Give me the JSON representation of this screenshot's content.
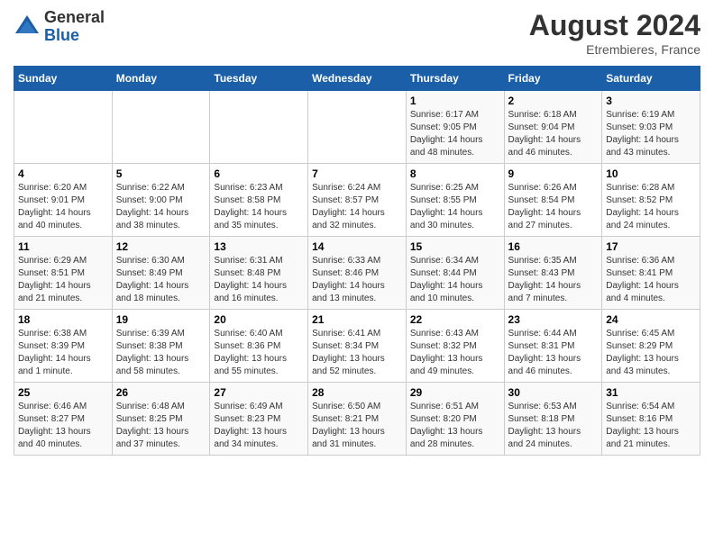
{
  "header": {
    "logo_general": "General",
    "logo_blue": "Blue",
    "month_year": "August 2024",
    "location": "Etrembieres, France"
  },
  "weekdays": [
    "Sunday",
    "Monday",
    "Tuesday",
    "Wednesday",
    "Thursday",
    "Friday",
    "Saturday"
  ],
  "weeks": [
    [
      {
        "day": "",
        "info": ""
      },
      {
        "day": "",
        "info": ""
      },
      {
        "day": "",
        "info": ""
      },
      {
        "day": "",
        "info": ""
      },
      {
        "day": "1",
        "info": "Sunrise: 6:17 AM\nSunset: 9:05 PM\nDaylight: 14 hours and 48 minutes."
      },
      {
        "day": "2",
        "info": "Sunrise: 6:18 AM\nSunset: 9:04 PM\nDaylight: 14 hours and 46 minutes."
      },
      {
        "day": "3",
        "info": "Sunrise: 6:19 AM\nSunset: 9:03 PM\nDaylight: 14 hours and 43 minutes."
      }
    ],
    [
      {
        "day": "4",
        "info": "Sunrise: 6:20 AM\nSunset: 9:01 PM\nDaylight: 14 hours and 40 minutes."
      },
      {
        "day": "5",
        "info": "Sunrise: 6:22 AM\nSunset: 9:00 PM\nDaylight: 14 hours and 38 minutes."
      },
      {
        "day": "6",
        "info": "Sunrise: 6:23 AM\nSunset: 8:58 PM\nDaylight: 14 hours and 35 minutes."
      },
      {
        "day": "7",
        "info": "Sunrise: 6:24 AM\nSunset: 8:57 PM\nDaylight: 14 hours and 32 minutes."
      },
      {
        "day": "8",
        "info": "Sunrise: 6:25 AM\nSunset: 8:55 PM\nDaylight: 14 hours and 30 minutes."
      },
      {
        "day": "9",
        "info": "Sunrise: 6:26 AM\nSunset: 8:54 PM\nDaylight: 14 hours and 27 minutes."
      },
      {
        "day": "10",
        "info": "Sunrise: 6:28 AM\nSunset: 8:52 PM\nDaylight: 14 hours and 24 minutes."
      }
    ],
    [
      {
        "day": "11",
        "info": "Sunrise: 6:29 AM\nSunset: 8:51 PM\nDaylight: 14 hours and 21 minutes."
      },
      {
        "day": "12",
        "info": "Sunrise: 6:30 AM\nSunset: 8:49 PM\nDaylight: 14 hours and 18 minutes."
      },
      {
        "day": "13",
        "info": "Sunrise: 6:31 AM\nSunset: 8:48 PM\nDaylight: 14 hours and 16 minutes."
      },
      {
        "day": "14",
        "info": "Sunrise: 6:33 AM\nSunset: 8:46 PM\nDaylight: 14 hours and 13 minutes."
      },
      {
        "day": "15",
        "info": "Sunrise: 6:34 AM\nSunset: 8:44 PM\nDaylight: 14 hours and 10 minutes."
      },
      {
        "day": "16",
        "info": "Sunrise: 6:35 AM\nSunset: 8:43 PM\nDaylight: 14 hours and 7 minutes."
      },
      {
        "day": "17",
        "info": "Sunrise: 6:36 AM\nSunset: 8:41 PM\nDaylight: 14 hours and 4 minutes."
      }
    ],
    [
      {
        "day": "18",
        "info": "Sunrise: 6:38 AM\nSunset: 8:39 PM\nDaylight: 14 hours and 1 minute."
      },
      {
        "day": "19",
        "info": "Sunrise: 6:39 AM\nSunset: 8:38 PM\nDaylight: 13 hours and 58 minutes."
      },
      {
        "day": "20",
        "info": "Sunrise: 6:40 AM\nSunset: 8:36 PM\nDaylight: 13 hours and 55 minutes."
      },
      {
        "day": "21",
        "info": "Sunrise: 6:41 AM\nSunset: 8:34 PM\nDaylight: 13 hours and 52 minutes."
      },
      {
        "day": "22",
        "info": "Sunrise: 6:43 AM\nSunset: 8:32 PM\nDaylight: 13 hours and 49 minutes."
      },
      {
        "day": "23",
        "info": "Sunrise: 6:44 AM\nSunset: 8:31 PM\nDaylight: 13 hours and 46 minutes."
      },
      {
        "day": "24",
        "info": "Sunrise: 6:45 AM\nSunset: 8:29 PM\nDaylight: 13 hours and 43 minutes."
      }
    ],
    [
      {
        "day": "25",
        "info": "Sunrise: 6:46 AM\nSunset: 8:27 PM\nDaylight: 13 hours and 40 minutes."
      },
      {
        "day": "26",
        "info": "Sunrise: 6:48 AM\nSunset: 8:25 PM\nDaylight: 13 hours and 37 minutes."
      },
      {
        "day": "27",
        "info": "Sunrise: 6:49 AM\nSunset: 8:23 PM\nDaylight: 13 hours and 34 minutes."
      },
      {
        "day": "28",
        "info": "Sunrise: 6:50 AM\nSunset: 8:21 PM\nDaylight: 13 hours and 31 minutes."
      },
      {
        "day": "29",
        "info": "Sunrise: 6:51 AM\nSunset: 8:20 PM\nDaylight: 13 hours and 28 minutes."
      },
      {
        "day": "30",
        "info": "Sunrise: 6:53 AM\nSunset: 8:18 PM\nDaylight: 13 hours and 24 minutes."
      },
      {
        "day": "31",
        "info": "Sunrise: 6:54 AM\nSunset: 8:16 PM\nDaylight: 13 hours and 21 minutes."
      }
    ]
  ]
}
